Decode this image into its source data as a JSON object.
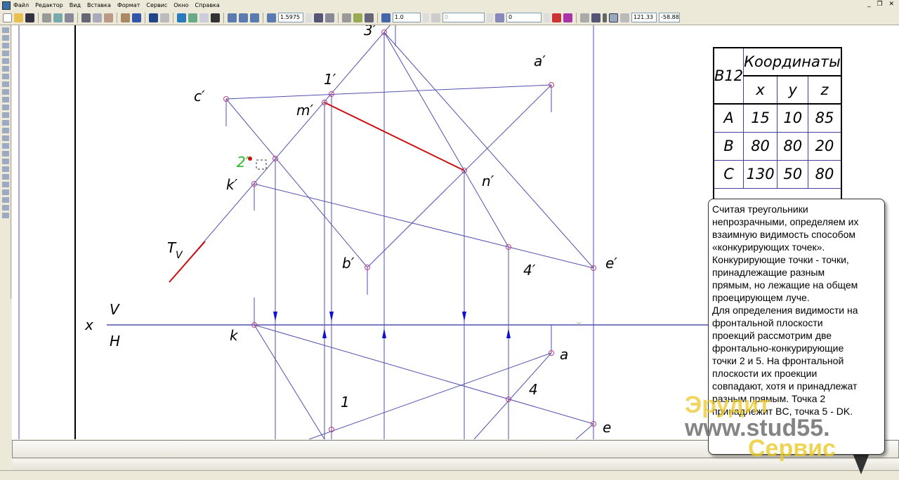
{
  "menu": [
    "Файл",
    "Редактор",
    "Вид",
    "Вставка",
    "Формат",
    "Сервис",
    "Окно",
    "Справка"
  ],
  "window_controls": "_ ❐ ✕",
  "toolbar": {
    "zoom_value": "1.5975",
    "style_value": "1.0",
    "field_blank": "0",
    "layer_value": "0",
    "coord_x": "121.33",
    "coord_y": "-58.88"
  },
  "table": {
    "title": "B12",
    "header": "Координаты",
    "axes": [
      "x",
      "y",
      "z"
    ],
    "rows": [
      {
        "point": "A",
        "x": "15",
        "y": "10",
        "z": "85"
      },
      {
        "point": "B",
        "x": "80",
        "y": "80",
        "z": "20"
      },
      {
        "point": "C",
        "x": "130",
        "y": "50",
        "z": "80"
      }
    ]
  },
  "labels": {
    "three_p": "3′",
    "one_p": "1′",
    "a_p": "a′",
    "c_p": "c′",
    "m_p": "m′",
    "two_p": "2′",
    "k_p": "k′",
    "n_p": "n′",
    "t_v": "T",
    "t_v_sub": "V",
    "b_p": "b′",
    "four_p": "4′",
    "e_p": "e′",
    "x": "x",
    "v": "V",
    "h": "H",
    "k": "k",
    "a": "a",
    "four": "4",
    "one": "1",
    "e": "e"
  },
  "tooltip": [
    "Считая треугольники",
    "непрозрачными, определяем их",
    "взаимную видимость способом",
    "«конкурирующих точек».",
    "Конкурирующие точки - точки,",
    "принадлежащие разным",
    "прямым, но лежащие на общем",
    "проецирующем луче.",
    "Для определения видимости на",
    "фронтальной плоскости",
    "проекций рассмотрим две",
    "фронтально-конкурирующие",
    "точки 2 и 5. На фронтальной",
    "плоскости их проекции",
    "совпадают, хотя и принадлежат",
    "разным прямым. Точка 2",
    "принадлежит BC, точка 5 - DK."
  ],
  "watermark": {
    "line1": "Эрудит",
    "line2": "www.stud55.",
    "line3": "Сервис"
  },
  "colors": {
    "construction": "#5050b0",
    "visible_red": "#cc1010",
    "point": "#c04080",
    "arrow": "#1010d0",
    "point_2_label": "#22bb22"
  }
}
